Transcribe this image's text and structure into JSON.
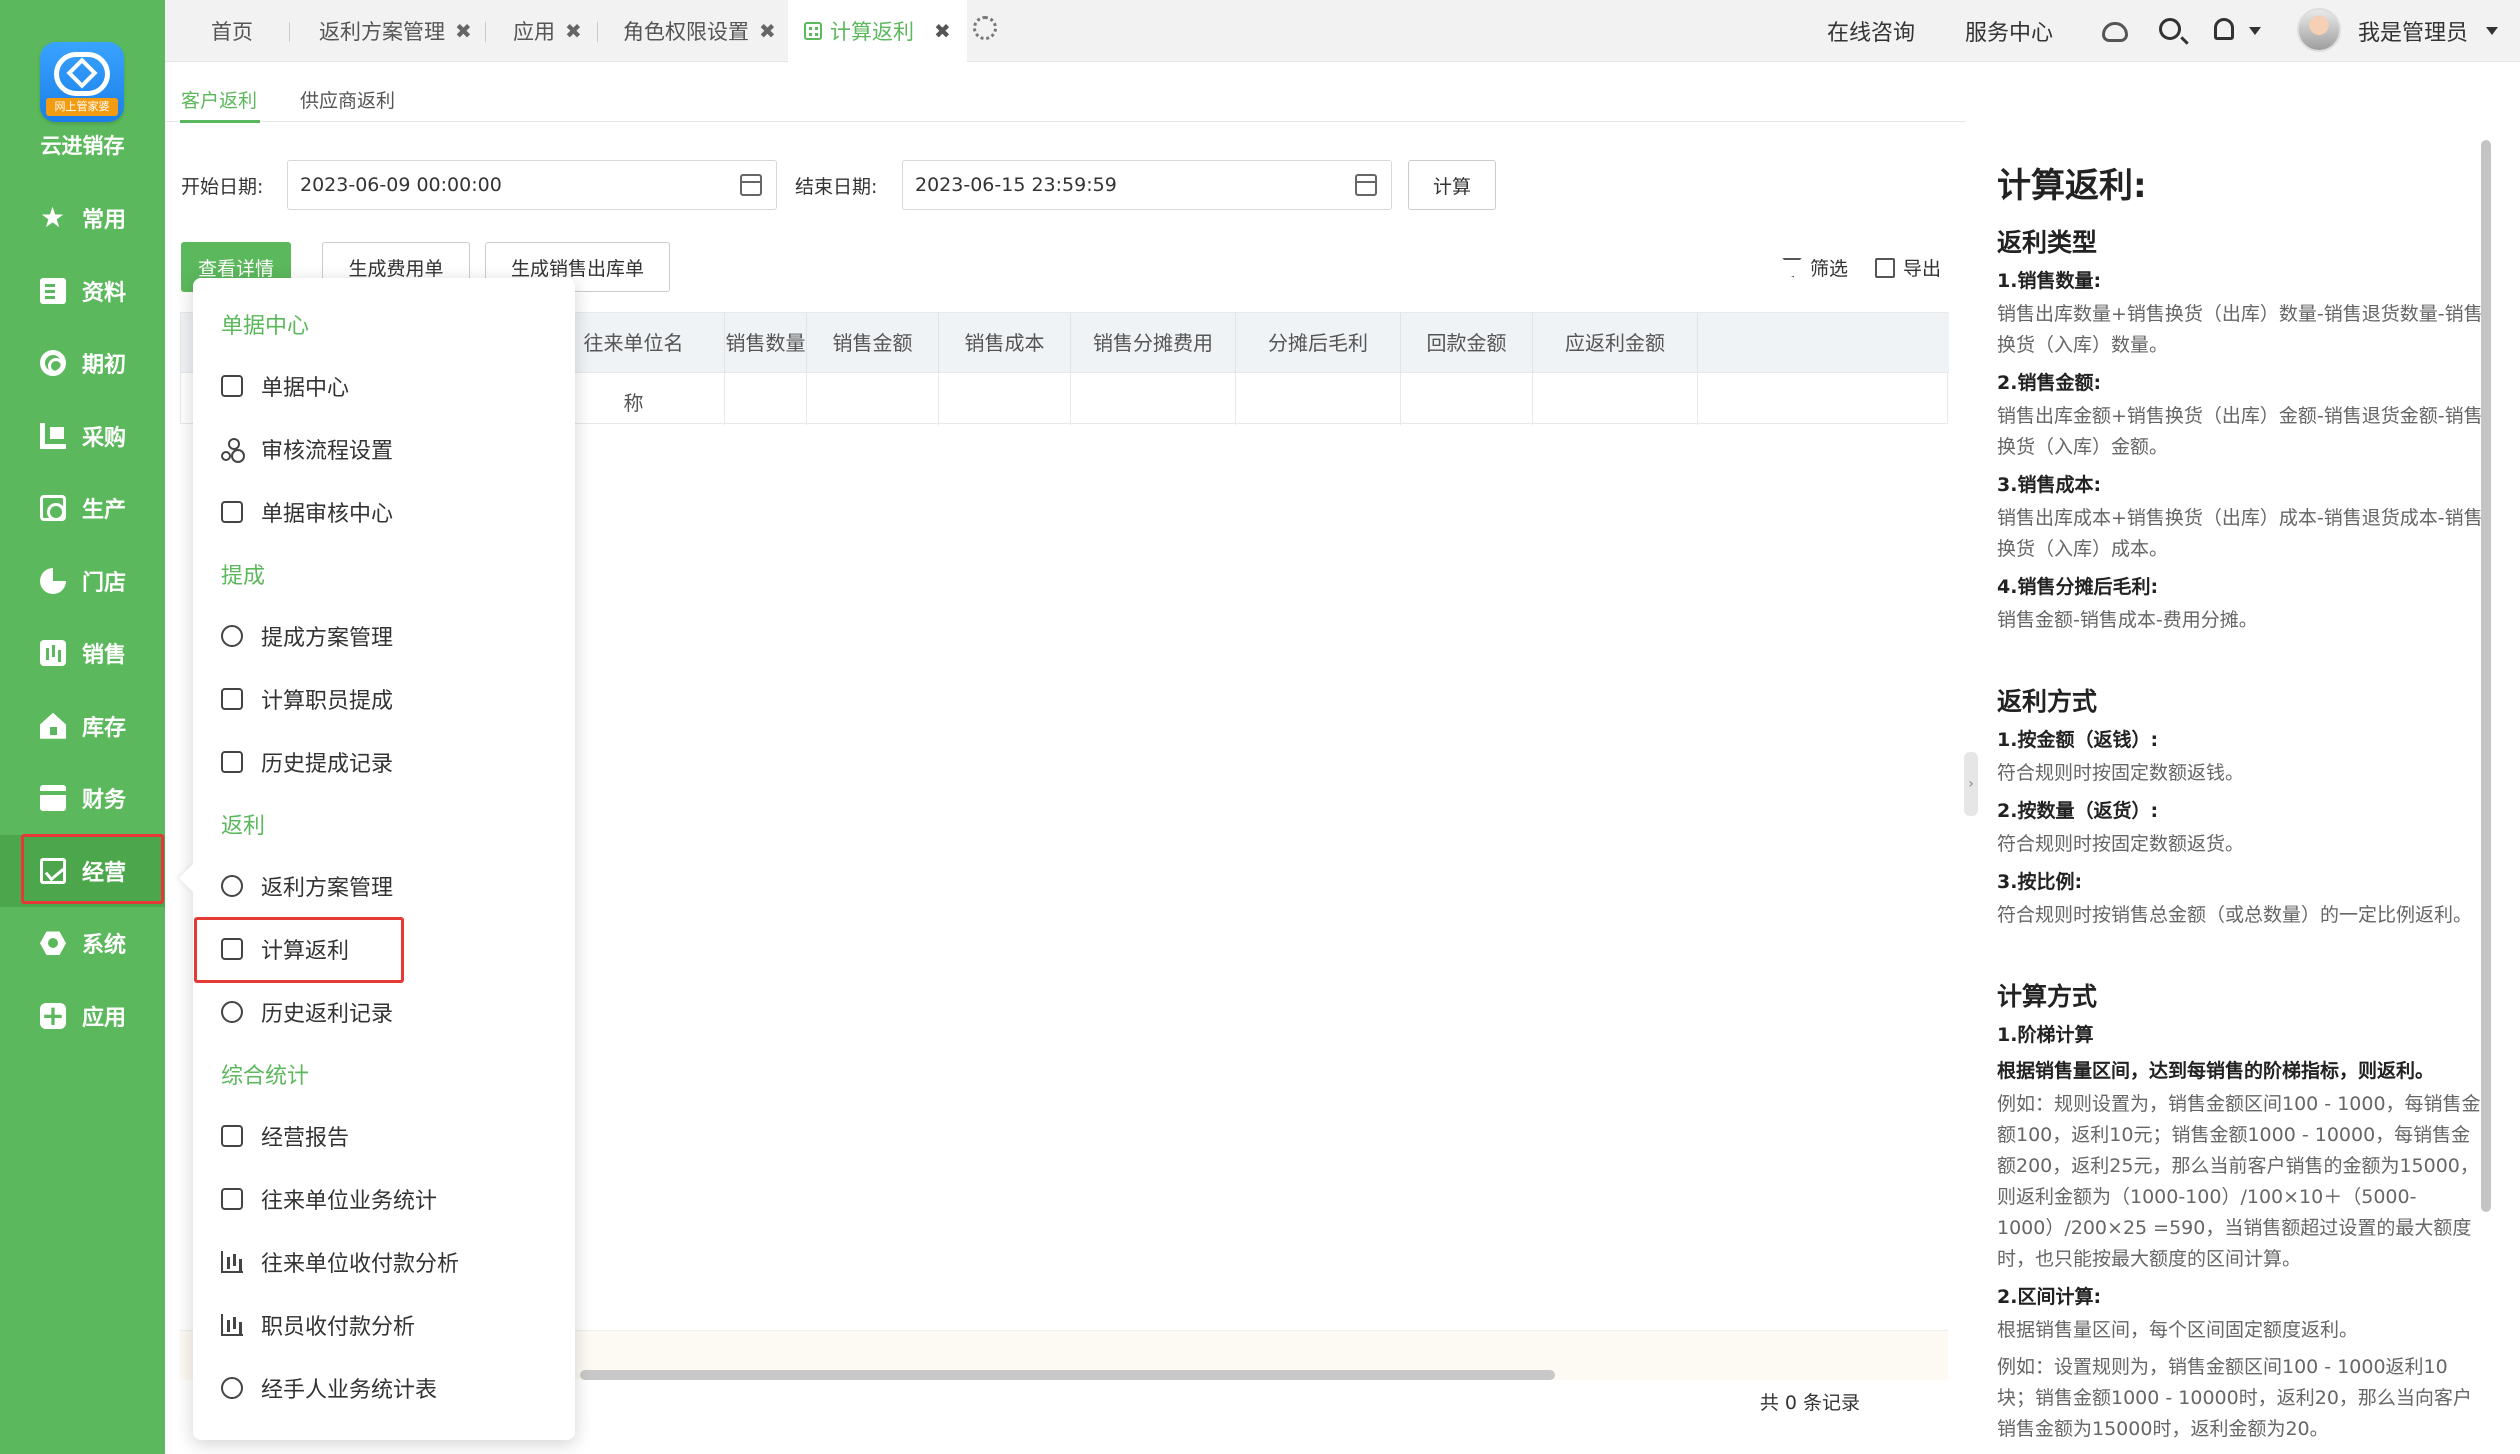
{
  "sidebar": {
    "logo_tag": "网上管家婆",
    "app_name": "云进销存",
    "items": [
      {
        "label": "常用",
        "icon": "star-icon"
      },
      {
        "label": "资料",
        "icon": "document-icon"
      },
      {
        "label": "期初",
        "icon": "target-icon"
      },
      {
        "label": "采购",
        "icon": "purchase-icon"
      },
      {
        "label": "生产",
        "icon": "production-icon"
      },
      {
        "label": "门店",
        "icon": "pie-icon"
      },
      {
        "label": "销售",
        "icon": "bar-chart-icon"
      },
      {
        "label": "库存",
        "icon": "house-icon"
      },
      {
        "label": "财务",
        "icon": "safe-icon"
      },
      {
        "label": "经营",
        "icon": "trend-icon",
        "active": true
      },
      {
        "label": "系统",
        "icon": "hexagon-icon"
      },
      {
        "label": "应用",
        "icon": "plus-icon"
      }
    ]
  },
  "tabs": [
    {
      "label": "首页",
      "closable": false
    },
    {
      "label": "返利方案管理",
      "closable": true
    },
    {
      "label": "应用",
      "closable": true
    },
    {
      "label": "角色权限设置",
      "closable": true
    },
    {
      "label": "计算返利",
      "closable": true,
      "active": true
    }
  ],
  "topbar": {
    "online_consult": "在线咨询",
    "service_center": "服务中心",
    "user_name": "我是管理员"
  },
  "subtabs": [
    "客户返利",
    "供应商返利"
  ],
  "filters": {
    "start_label": "开始日期:",
    "start_value": "2023-06-09 00:00:00",
    "end_label": "结束日期:",
    "end_value": "2023-06-15 23:59:59",
    "calc_button": "计算"
  },
  "actions": {
    "view_detail": "查看详情",
    "gen_expense": "生成费用单",
    "gen_sales_out": "生成销售出库单",
    "filter": "筛选",
    "export": "导出"
  },
  "table": {
    "columns": [
      "往来单位名称",
      "销售数量",
      "销售金额",
      "销售成本",
      "销售分摊费用",
      "分摊后毛利",
      "回款金额",
      "应返利金额"
    ],
    "rows": [],
    "footer": "共 0 条记录"
  },
  "dropdown": {
    "sections": [
      {
        "title": "单据中心",
        "items": [
          "单据中心",
          "审核流程设置",
          "单据审核中心"
        ]
      },
      {
        "title": "提成",
        "items": [
          "提成方案管理",
          "计算职员提成",
          "历史提成记录"
        ]
      },
      {
        "title": "返利",
        "items": [
          "返利方案管理",
          "计算返利",
          "历史返利记录"
        ]
      },
      {
        "title": "综合统计",
        "items": [
          "经营报告",
          "往来单位业务统计",
          "往来单位收付款分析",
          "职员收付款分析",
          "经手人业务统计表"
        ]
      }
    ]
  },
  "help": {
    "title": "计算返利:",
    "rebate_type": {
      "heading": "返利类型",
      "items": [
        {
          "name": "1.销售数量:",
          "desc": "销售出库数量+销售换货（出库）数量-销售退货数量-销售换货（入库）数量。"
        },
        {
          "name": "2.销售金额:",
          "desc": "销售出库金额+销售换货（出库）金额-销售退货金额-销售换货（入库）金额。"
        },
        {
          "name": "3.销售成本:",
          "desc": "销售出库成本+销售换货（出库）成本-销售退货成本-销售换货（入库）成本。"
        },
        {
          "name": "4.销售分摊后毛利:",
          "desc": "销售金额-销售成本-费用分摊。"
        }
      ]
    },
    "rebate_method": {
      "heading": "返利方式",
      "items": [
        {
          "name": "1.按金额（返钱）:",
          "desc": "符合规则时按固定数额返钱。"
        },
        {
          "name": "2.按数量（返货）:",
          "desc": "符合规则时按固定数额返货。"
        },
        {
          "name": "3.按比例:",
          "desc": "符合规则时按销售总金额（或总数量）的一定比例返利。"
        }
      ]
    },
    "calc_method": {
      "heading": "计算方式",
      "step_name": "1.阶梯计算",
      "step_rule": "根据销售量区间，达到每销售的阶梯指标，则返利。",
      "step_example": "例如：规则设置为，销售金额区间100 - 1000，每销售金额100，返利10元；销售金额1000 - 10000，每销售金额200，返利25元，那么当前客户销售的金额为15000，则返利金额为（1000-100）/100×10＋（5000-1000）/200×25 =590，当销售额超过设置的最大额度时，也只能按最大额度的区间计算。",
      "range_name": "2.区间计算:",
      "range_rule": "根据销售量区间，每个区间固定额度返利。",
      "range_example": "例如：设置规则为，销售金额区间100 - 1000返利10块；销售金额1000 - 10000时，返利20，那么当向客户销售金额为15000时，返利金额为20。"
    }
  },
  "colors": {
    "brand": "#5cb85c",
    "highlight": "#e53935"
  }
}
